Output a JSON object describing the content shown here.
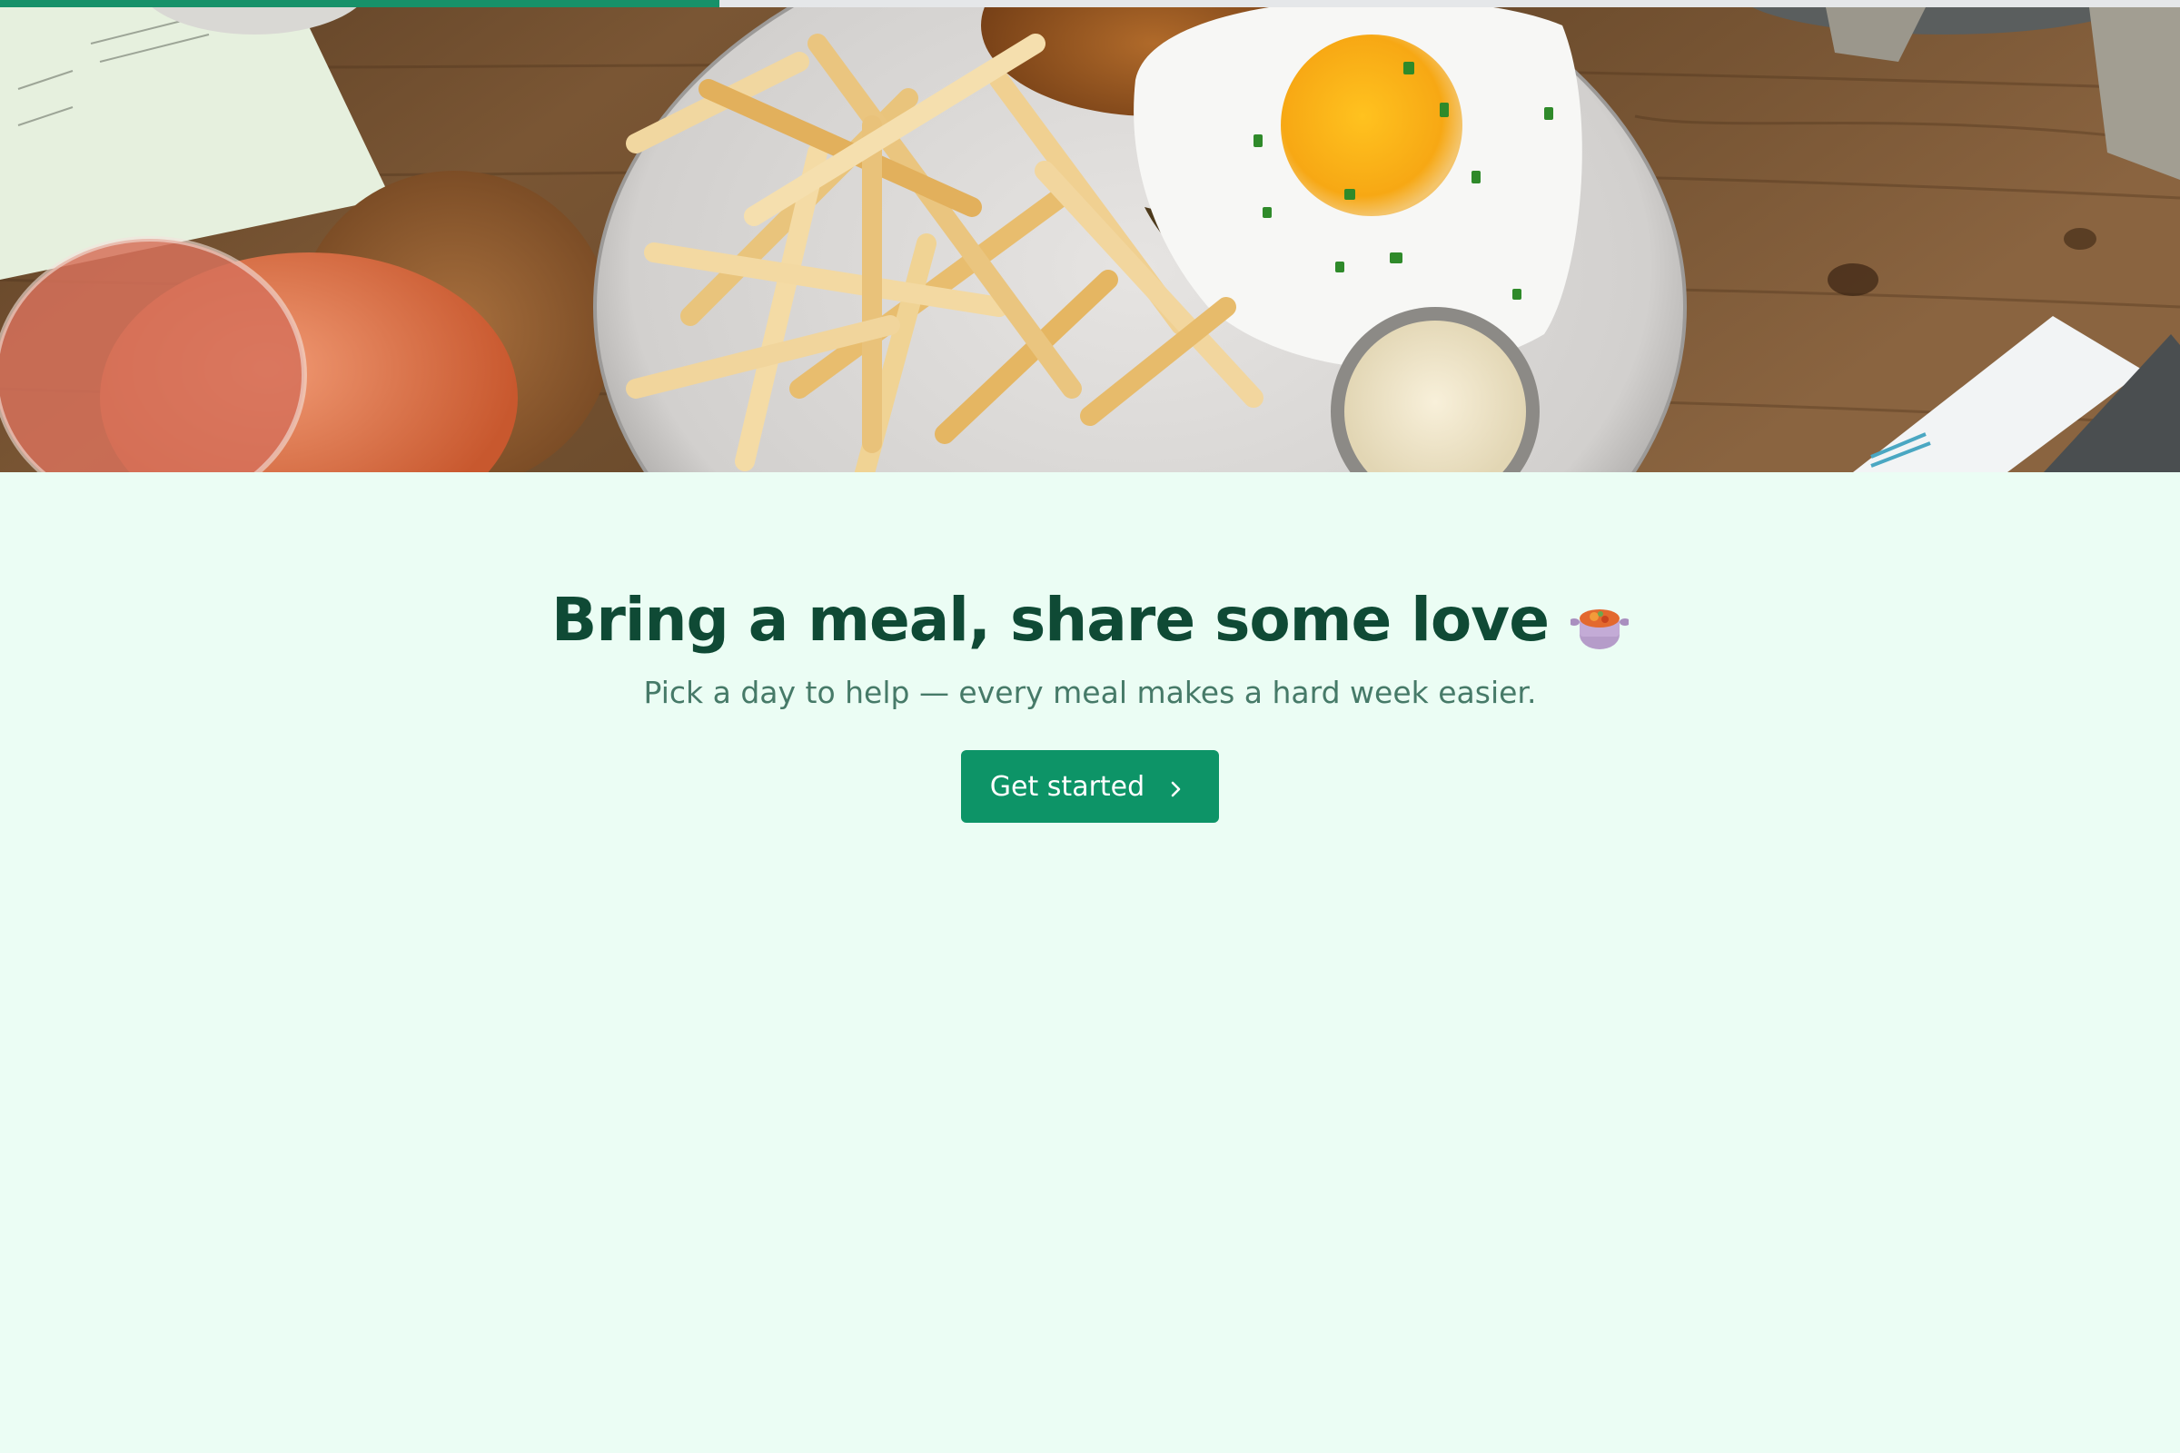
{
  "progress": {
    "value": 0.33,
    "color": "#179169"
  },
  "hero": {
    "image": "food-photo-burger-fries-egg"
  },
  "headline": {
    "text": "Bring a meal, share some love",
    "icon": "stew-pot-icon"
  },
  "subtitle": {
    "text": "Pick a day to help — every meal makes a hard week easier."
  },
  "cta": {
    "label": "Get started",
    "icon": "chevron-right-icon",
    "color": "#0d9467"
  },
  "colors": {
    "background": "#ebfdf4",
    "heading": "#0f4a35",
    "subtitle": "#467a68"
  }
}
